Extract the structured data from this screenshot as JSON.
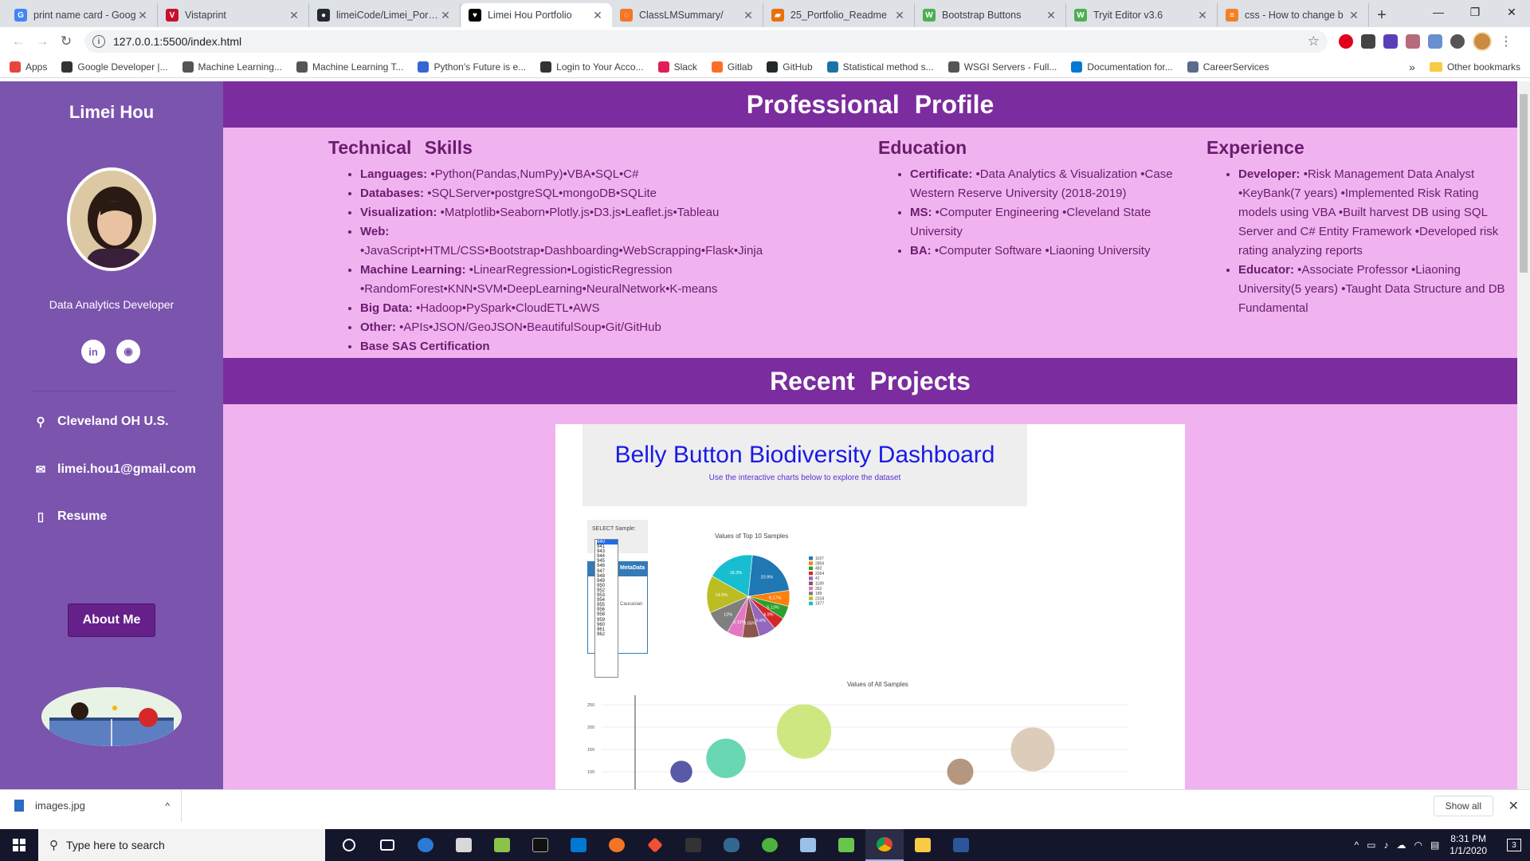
{
  "browser": {
    "tabs": [
      {
        "title": "print name card - Goog",
        "icon": "google-icon",
        "color": "#4285f4",
        "glyph": "G"
      },
      {
        "title": "Vistaprint",
        "icon": "vistaprint-icon",
        "color": "#c8102e",
        "glyph": "V"
      },
      {
        "title": "limeiCode/Limei_Portfo",
        "icon": "github-icon",
        "color": "#24292e",
        "glyph": "●"
      },
      {
        "title": "Limei Hou Portfolio",
        "icon": "heart-icon",
        "color": "#000000",
        "glyph": "♥",
        "active": true
      },
      {
        "title": "ClassLMSummary/",
        "icon": "jupyter-icon",
        "color": "#f37626",
        "glyph": "◌"
      },
      {
        "title": "25_Portfolio_Readme",
        "icon": "document-icon",
        "color": "#e8710a",
        "glyph": "▰"
      },
      {
        "title": "Bootstrap Buttons",
        "icon": "w3schools-icon",
        "color": "#4caf50",
        "glyph": "W"
      },
      {
        "title": "Tryit Editor v3.6",
        "icon": "w3schools-icon",
        "color": "#4caf50",
        "glyph": "W"
      },
      {
        "title": "css - How to change b",
        "icon": "stackoverflow-icon",
        "color": "#f48024",
        "glyph": "≡"
      }
    ],
    "new_tab": "+",
    "url": "127.0.0.1:5500/index.html",
    "bookmarks": [
      {
        "label": "Apps",
        "icon": "apps-icon",
        "color": "#e8453c"
      },
      {
        "label": "Google Developer |...",
        "icon": "code-icon",
        "color": "#333333"
      },
      {
        "label": "Machine Learning...",
        "icon": "diamond-icon",
        "color": "#555555"
      },
      {
        "label": "Machine Learning T...",
        "icon": "diamond-icon",
        "color": "#555555"
      },
      {
        "label": "Python's Future is e...",
        "icon": "refresh-icon",
        "color": "#3367d6"
      },
      {
        "label": "Login to Your Acco...",
        "icon": "compass-icon",
        "color": "#333333"
      },
      {
        "label": "Slack",
        "icon": "slack-icon",
        "color": "#e01e5a"
      },
      {
        "label": "Gitlab",
        "icon": "gitlab-icon",
        "color": "#fc6d26"
      },
      {
        "label": "GitHub",
        "icon": "github-icon",
        "color": "#24292e"
      },
      {
        "label": "Statistical method s...",
        "icon": "delta-icon",
        "color": "#1a73a8"
      },
      {
        "label": "WSGI Servers - Full...",
        "icon": "diamond-icon",
        "color": "#555555"
      },
      {
        "label": "Documentation for...",
        "icon": "vscode-icon",
        "color": "#0078d4"
      },
      {
        "label": "CareerServices",
        "icon": "window-icon",
        "color": "#5b6b8c"
      }
    ],
    "more": "»",
    "other_bookmarks": "Other bookmarks"
  },
  "sidebar": {
    "name": "Limei Hou",
    "role": "Data Analytics Developer",
    "social": [
      {
        "label": "in",
        "icon": "linkedin-icon"
      },
      {
        "label": "◉",
        "icon": "github-icon"
      }
    ],
    "location": "Cleveland OH U.S.",
    "email": "limei.hou1@gmail.com",
    "resume": "Resume",
    "about": "About Me"
  },
  "profile": {
    "heading": "Professional  Profile",
    "skills": {
      "title": "Technical  Skills",
      "items": [
        {
          "k": "Languages:",
          "v": " •Python(Pandas,NumPy)•VBA•SQL•C#"
        },
        {
          "k": "Databases:",
          "v": " •SQLServer•postgreSQL•mongoDB•SQLite"
        },
        {
          "k": "Visualization:",
          "v": " •Matplotlib•Seaborn•Plotly.js•D3.js•Leaflet.js•Tableau"
        },
        {
          "k": "Web:",
          "v": " •JavaScript•HTML/CSS•Bootstrap•Dashboarding•WebScrapping•Flask•Jinja"
        },
        {
          "k": "Machine Learning:",
          "v": " •LinearRegression•LogisticRegression •RandomForest•KNN•SVM•DeepLearning•NeuralNetwork•K-means"
        },
        {
          "k": "Big Data:",
          "v": " •Hadoop•PySpark•CloudETL•AWS"
        },
        {
          "k": "Other:",
          "v": " •APIs•JSON/GeoJSON•BeautifulSoup•Git/GitHub"
        },
        {
          "k": "Base SAS Certification",
          "v": ""
        }
      ]
    },
    "education": {
      "title": "Education",
      "items": [
        {
          "k": "Certificate:",
          "v": " •Data Analytics & Visualization •Case Western Reserve University (2018-2019)"
        },
        {
          "k": "MS:",
          "v": " •Computer Engineering •Cleveland State University"
        },
        {
          "k": "BA:",
          "v": " •Computer Software •Liaoning University"
        }
      ]
    },
    "experience": {
      "title": "Experience",
      "items": [
        {
          "k": "Developer:",
          "v": " •Risk Management Data Analyst •KeyBank(7 years) •Implemented Risk Rating models using VBA •Built harvest DB using SQL Server and C# Entity Framework •Developed risk rating analyzing reports"
        },
        {
          "k": "Educator:",
          "v": " •Associate Professor •Liaoning University(5 years) •Taught Data Structure and DB Fundamental"
        }
      ]
    }
  },
  "projects": {
    "heading": "Recent  Projects",
    "dashboard": {
      "title": "Belly Button Biodiversity Dashboard",
      "subtitle": "Use the interactive charts below to explore the dataset",
      "select_label": "SELECT Sample:",
      "selected": "940",
      "metadata_title": "MetaData",
      "metadata_value": "Caucasian",
      "options": [
        "940",
        "941",
        "943",
        "944",
        "945",
        "946",
        "947",
        "948",
        "949",
        "950",
        "952",
        "953",
        "954",
        "955",
        "956",
        "958",
        "959",
        "960",
        "961",
        "962"
      ]
    },
    "pie_chart": {
      "type": "pie",
      "title": "Values of Top 10 Samples",
      "labels": [
        "1167",
        "2859",
        "482",
        "2264",
        "41",
        "1189",
        "352",
        "189",
        "2318",
        "1977"
      ],
      "values": [
        20.9,
        6.17,
        5.13,
        4.9,
        6.6,
        6.55,
        6.11,
        10,
        14.5,
        18.3
      ],
      "slice_labels": [
        "20.9%",
        "6.17%",
        "5.13%",
        "4.9%",
        "6.6%",
        "6.55%",
        "6.11%",
        "10%",
        "14.5%",
        "18.3%"
      ],
      "colors": [
        "#1f77b4",
        "#ff7f0e",
        "#2ca02c",
        "#d62728",
        "#9467bd",
        "#8c564b",
        "#e377c2",
        "#7f7f7f",
        "#bcbd22",
        "#17becf"
      ],
      "legend": "right"
    },
    "bubble_chart": {
      "type": "scatter",
      "title": "Values of All Samples",
      "yticks": [
        "250",
        "200",
        "150",
        "100"
      ],
      "points": [
        {
          "x": 0.12,
          "y": 100,
          "r": 0.25,
          "color": "#3b3d99"
        },
        {
          "x": 0.2,
          "y": 130,
          "r": 0.45,
          "color": "#4fd0a6"
        },
        {
          "x": 0.34,
          "y": 190,
          "r": 0.62,
          "color": "#c7e36b"
        },
        {
          "x": 0.62,
          "y": 100,
          "r": 0.3,
          "color": "#a8856a"
        },
        {
          "x": 0.75,
          "y": 150,
          "r": 0.5,
          "color": "#d8c3ae"
        }
      ]
    }
  },
  "downloads": {
    "file": "images.jpg",
    "show_all": "Show all"
  },
  "taskbar": {
    "search_placeholder": "Type here to search",
    "time": "8:31 PM",
    "date": "1/1/2020",
    "notification_count": "3"
  }
}
